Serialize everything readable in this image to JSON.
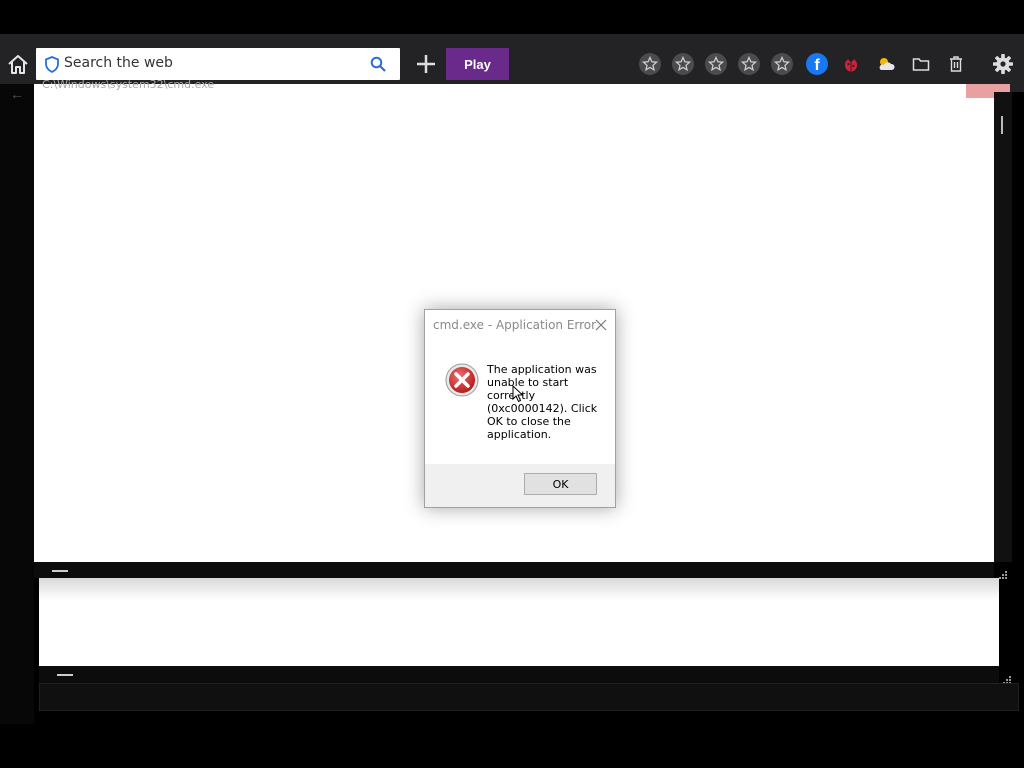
{
  "toolbar": {
    "search_placeholder": "Search the web",
    "play_label": "Play",
    "favorite_count": 5,
    "icons": [
      "home-icon",
      "shield-icon",
      "search-icon",
      "plus-icon",
      "star-icon",
      "star-icon",
      "star-icon",
      "star-icon",
      "star-icon",
      "facebook-icon",
      "ladybug-icon",
      "weather-icon",
      "folder-icon",
      "trash-icon",
      "gear-icon"
    ],
    "accent_color": "#6a2a8c"
  },
  "cmd_window": {
    "title": "C:\\Windows\\system32\\cmd.exe"
  },
  "dialog": {
    "title": "cmd.exe - Application Error",
    "message": "The application was unable to start correctly (0xc0000142). Click OK to close the application.",
    "ok_label": "OK",
    "icon": "error-icon"
  }
}
